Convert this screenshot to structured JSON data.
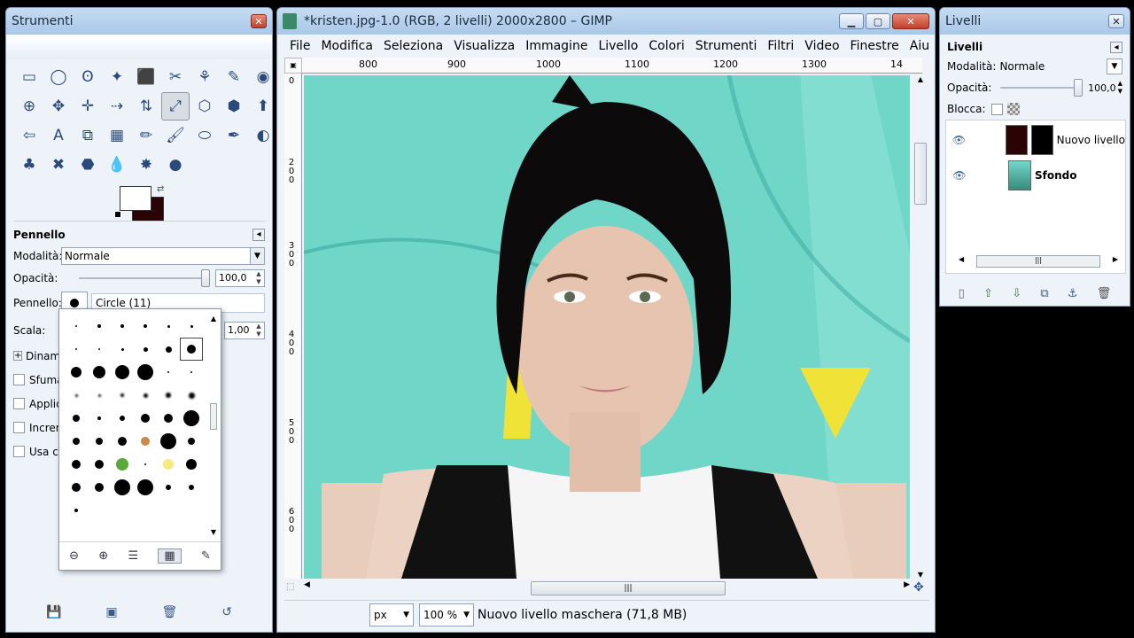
{
  "toolbox": {
    "title": "Strumenti",
    "close_label": "✕",
    "tools": [
      "▭",
      "◯",
      "ʘ",
      "✦",
      "⬛",
      "✂",
      "⚘",
      "✎",
      "◉",
      "⊕",
      "✥",
      "✛",
      "⇢",
      "⇅",
      "⤢",
      "⬡",
      "⬢",
      "⬆",
      "⇦",
      "A",
      "⧉",
      "▦",
      "✏",
      "🖌",
      "⬭",
      "✒",
      "◐",
      "♣",
      "✖",
      "⬣",
      "💧",
      "✸",
      "●"
    ],
    "active_tool_index": 14,
    "options": {
      "header": "Pennello",
      "mode_label": "Modalità:",
      "mode_value": "Normale",
      "opacity_label": "Opacità:",
      "opacity_value": "100,0",
      "opacity_fraction": 1.0,
      "brush_label": "Pennello:",
      "brush_name": "Circle (11)",
      "scale_label": "Scala:",
      "scale_value": "1,00",
      "checks": [
        "Dinam",
        "Sfuma",
        "Applic",
        "Increm",
        "Usa co"
      ]
    }
  },
  "gimp": {
    "title": "*kristen.jpg-1.0 (RGB, 2 livelli) 2000x2800 – GIMP",
    "menu": [
      "File",
      "Modifica",
      "Seleziona",
      "Visualizza",
      "Immagine",
      "Livello",
      "Colori",
      "Strumenti",
      "Filtri",
      "Video",
      "Finestre",
      "Aiu"
    ],
    "ruler_h": [
      "800",
      "900",
      "1000",
      "1100",
      "1200",
      "1300",
      "14"
    ],
    "ruler_v": [
      "0",
      "200",
      "300",
      "400",
      "500",
      "600"
    ],
    "unit": "px",
    "zoom": "100 %",
    "status": "Nuovo livello maschera (71,8 MB)"
  },
  "layers": {
    "title": "Livelli",
    "header": "Livelli",
    "mode_label": "Modalità:",
    "mode_value": "Normale",
    "opacity_label": "Opacità:",
    "opacity_value": "100,0",
    "lock_label": "Blocca:",
    "items": [
      {
        "name": "Nuovo livello"
      },
      {
        "name": "Sfondo"
      }
    ]
  },
  "colors": {
    "fg": "#ffffff",
    "bg": "#2a0404",
    "sky": "#6fd8ca"
  }
}
